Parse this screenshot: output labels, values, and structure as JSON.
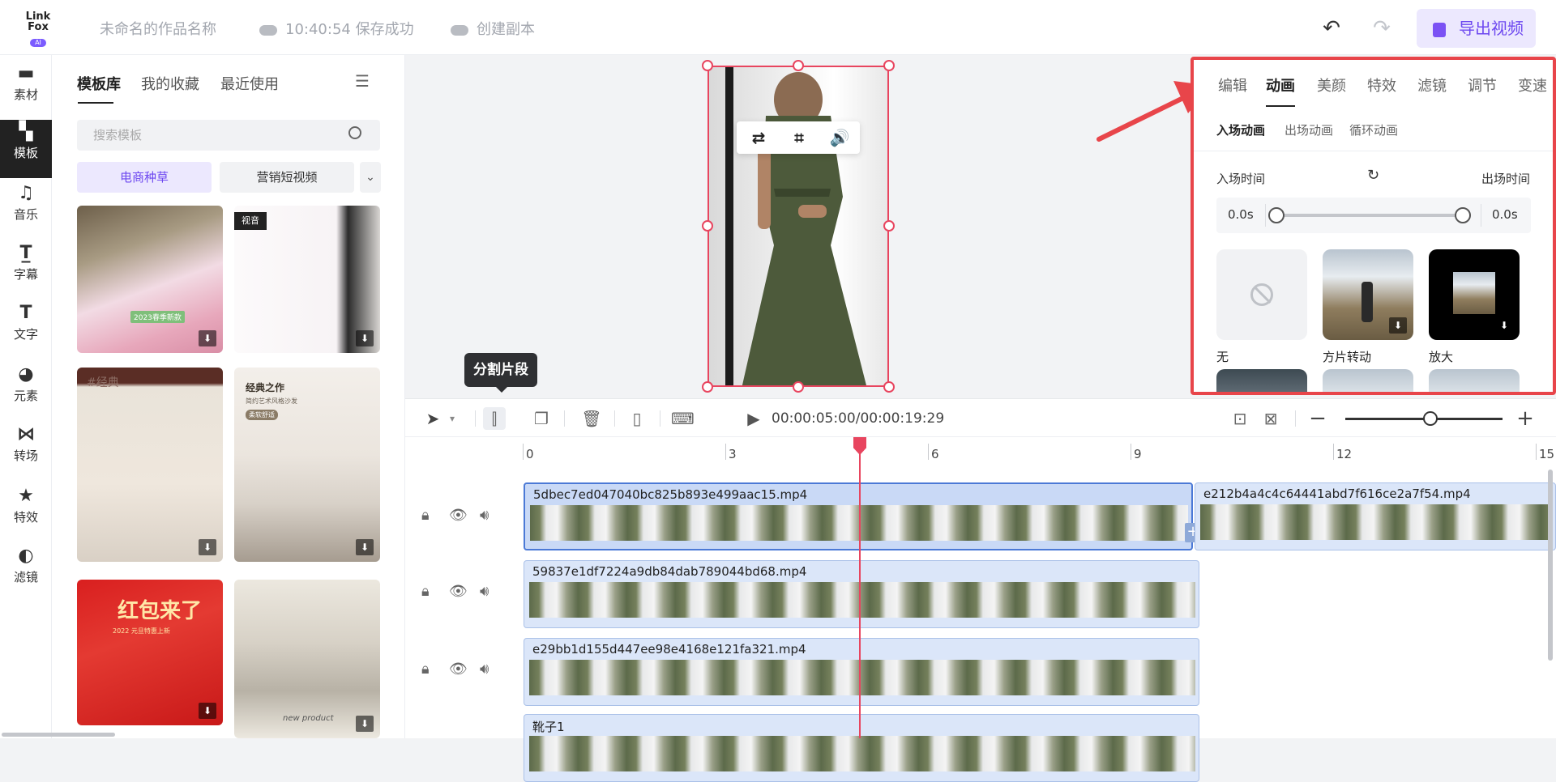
{
  "header": {
    "logo_line1": "Link",
    "logo_line2": "Fox",
    "logo_badge": "AI",
    "project_name": "未命名的作品名称",
    "save_status": "10:40:54 保存成功",
    "copy_label": "创建副本",
    "export_label": "导出视频"
  },
  "rail": {
    "items": [
      {
        "label": "素材",
        "icon": "material-icon"
      },
      {
        "label": "模板",
        "icon": "template-icon"
      },
      {
        "label": "音乐",
        "icon": "music-icon"
      },
      {
        "label": "字幕",
        "icon": "subtitle-icon"
      },
      {
        "label": "文字",
        "icon": "text-icon"
      },
      {
        "label": "元素",
        "icon": "element-icon"
      },
      {
        "label": "转场",
        "icon": "transition-icon"
      },
      {
        "label": "特效",
        "icon": "effect-icon"
      },
      {
        "label": "滤镜",
        "icon": "filter-icon"
      }
    ]
  },
  "templates": {
    "tabs": [
      "模板库",
      "我的收藏",
      "最近使用"
    ],
    "search_placeholder": "搜索模板",
    "chips": [
      "电商种草",
      "营销短视频"
    ],
    "thumb_texts": {
      "t1_badge": "2023春季新款",
      "t2_badge": "视音",
      "t3_text": "#经典",
      "t4_title": "经典之作",
      "t4_sub": "简约艺术风格沙发",
      "t4_tag": "柔软舒适",
      "t5_title": "红包来了",
      "t5_sub": "2022 元旦特惠上新",
      "t6_text": "new product"
    }
  },
  "preview": {
    "toolbar_icons": [
      "swap-icon",
      "crop-icon",
      "volume-icon"
    ]
  },
  "right_panel": {
    "tabs": [
      "编辑",
      "动画",
      "美颜",
      "特效",
      "滤镜",
      "调节",
      "变速"
    ],
    "active_tab": "动画",
    "sub_tabs": [
      "入场动画",
      "出场动画",
      "循环动画"
    ],
    "enter_time_label": "入场时间",
    "exit_time_label": "出场时间",
    "enter_time": "0.0s",
    "exit_time": "0.0s",
    "animations": [
      "无",
      "方片转动",
      "放大"
    ]
  },
  "tooltip": "分割片段",
  "timeline": {
    "timecode": "00:00:05:00/00:00:19:29",
    "ticks": [
      "0",
      "3",
      "6",
      "9",
      "12",
      "15"
    ],
    "clips": [
      {
        "name": "5dbec7ed047040bc825b893e499aac15.mp4"
      },
      {
        "name": "e212b4a4c4c64441abd7f616ce2a7f54.mp4"
      },
      {
        "name": "59837e1df7224a9db84dab789044bd68.mp4"
      },
      {
        "name": "e29bb1d155d447ee98e4168e121fa321.mp4"
      },
      {
        "name": "靴子1"
      }
    ]
  },
  "colors": {
    "accent": "#6d48f0",
    "highlight_border": "#e8454a",
    "playhead": "#e8455f"
  }
}
